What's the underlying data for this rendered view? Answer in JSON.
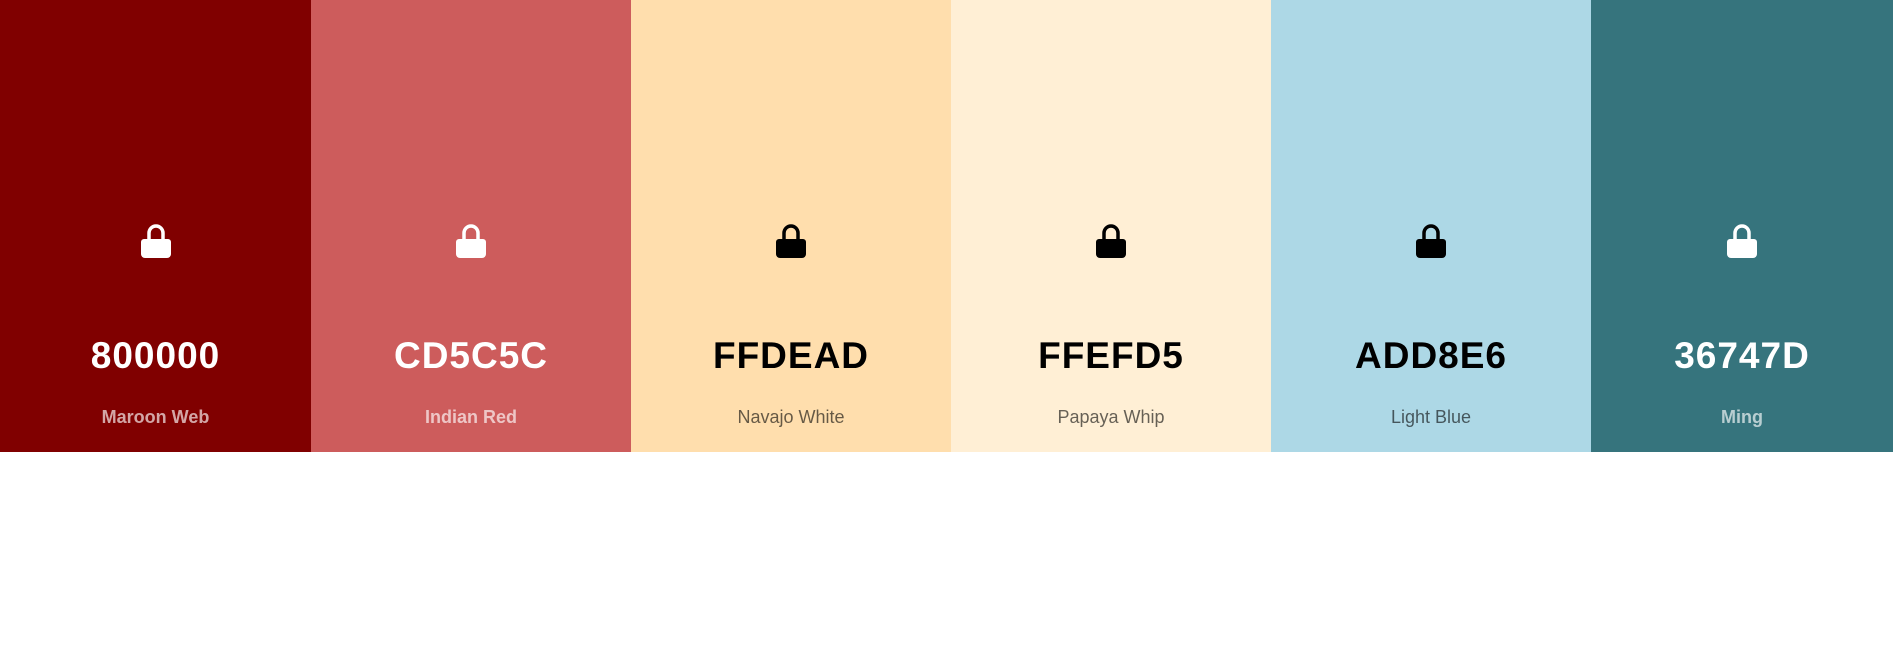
{
  "swatches": [
    {
      "hex": "800000",
      "name": "Maroon Web",
      "color": "#800000",
      "text_tone": "light",
      "lock_icon": "lock-icon"
    },
    {
      "hex": "CD5C5C",
      "name": "Indian Red",
      "color": "#CD5C5C",
      "text_tone": "light",
      "lock_icon": "lock-icon"
    },
    {
      "hex": "FFDEAD",
      "name": "Navajo White",
      "color": "#FFDEAD",
      "text_tone": "dark",
      "lock_icon": "lock-icon"
    },
    {
      "hex": "FFEFD5",
      "name": "Papaya Whip",
      "color": "#FFEFD5",
      "text_tone": "dark",
      "lock_icon": "lock-icon"
    },
    {
      "hex": "ADD8E6",
      "name": "Light Blue",
      "color": "#ADD8E6",
      "text_tone": "dark",
      "lock_icon": "lock-icon"
    },
    {
      "hex": "36747D",
      "name": "Ming",
      "color": "#36747D",
      "text_tone": "light",
      "lock_icon": "lock-icon"
    }
  ]
}
